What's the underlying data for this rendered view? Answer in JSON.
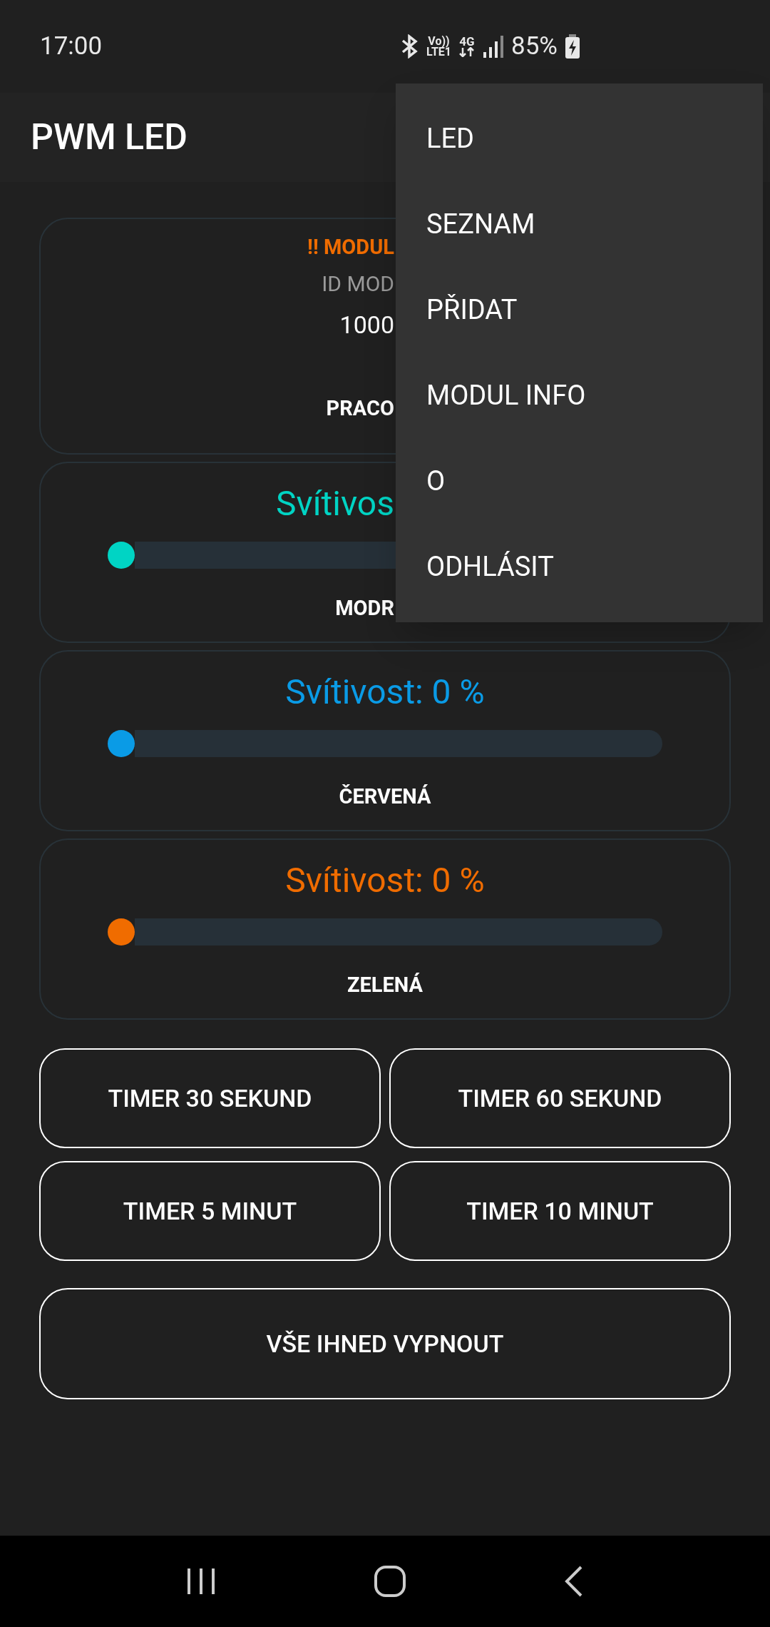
{
  "status_bar": {
    "time": "17:00",
    "volte": [
      "Vo))",
      "LTE1"
    ],
    "network": "4G",
    "battery": "85%"
  },
  "app_bar": {
    "title": "PWM LED"
  },
  "module_card": {
    "warning": "!! MODUL",
    "id_label": "ID MOD",
    "id_value": "1000",
    "status": "PRACO"
  },
  "channels": [
    {
      "reading": "Svítivos",
      "name": "MODR",
      "level": 0,
      "color": "#00d4c4",
      "covered": true
    },
    {
      "reading": "Svítivost: 0 %",
      "name": "ČERVENÁ",
      "level": 0,
      "color": "#0a9be6",
      "covered": false
    },
    {
      "reading": "Svítivost: 0 %",
      "name": "ZELENÁ",
      "level": 0,
      "color": "#f06c00",
      "covered": false
    }
  ],
  "timer_buttons": [
    "TIMER 30 SEKUND",
    "TIMER 60 SEKUND",
    "TIMER 5 MINUT",
    "TIMER 10 MINUT"
  ],
  "off_button": "VŠE IHNED VYPNOUT",
  "menu": {
    "items": [
      "LED",
      "SEZNAM",
      "PŘIDAT",
      "MODUL INFO",
      "O",
      "ODHLÁSIT"
    ]
  }
}
